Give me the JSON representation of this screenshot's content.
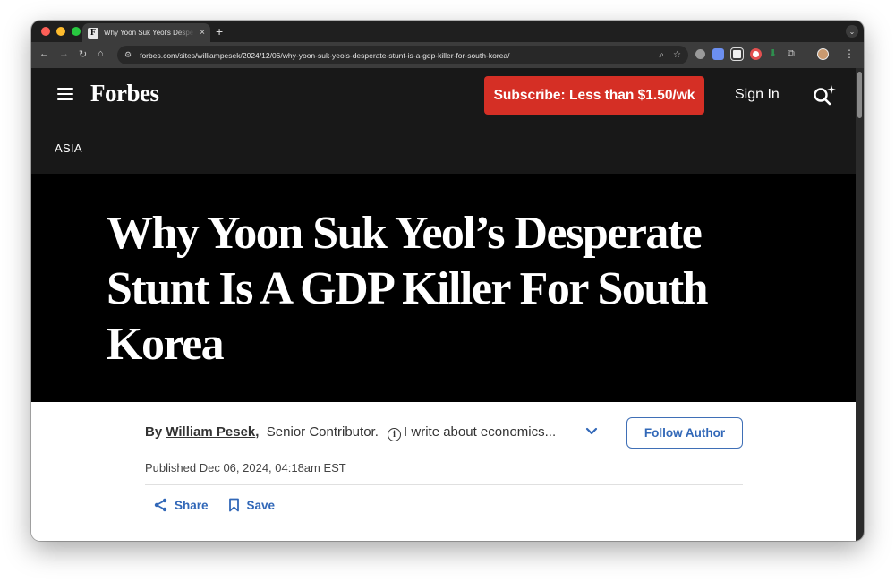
{
  "browser": {
    "tab_title": "Why Yoon Suk Yeol's Despera",
    "favicon_letter": "F",
    "tab_close": "×",
    "new_tab": "+",
    "url": "forbes.com/sites/williampesek/2024/12/06/why-yoon-suk-yeols-desperate-stunt-is-a-gdp-killer-for-south-korea/",
    "icons": [
      "back-icon",
      "forward-icon",
      "reload-icon",
      "home-icon",
      "site-settings-icon",
      "zoom-icon",
      "bookmark-star-icon",
      "menu-icon"
    ]
  },
  "header": {
    "logo": "Forbes",
    "subscribe_label": "Subscribe: Less than $1.50/wk",
    "signin_label": "Sign In",
    "section": "ASIA"
  },
  "article": {
    "headline": "Why Yoon Suk Yeol’s Desperate Stunt Is A GDP Killer For South Korea",
    "by_prefix": "By",
    "author": "William Pesek",
    "role": "Senior Contributor.",
    "bio": "I write about economics...",
    "follow_label": "Follow Author",
    "published": "Published Dec 06, 2024, 04:18am EST",
    "share_label": "Share",
    "save_label": "Save"
  },
  "colors": {
    "header_bg": "#181818",
    "hero_bg": "#000000",
    "subscribe_bg": "#d52f25",
    "link_blue": "#3268b8"
  }
}
